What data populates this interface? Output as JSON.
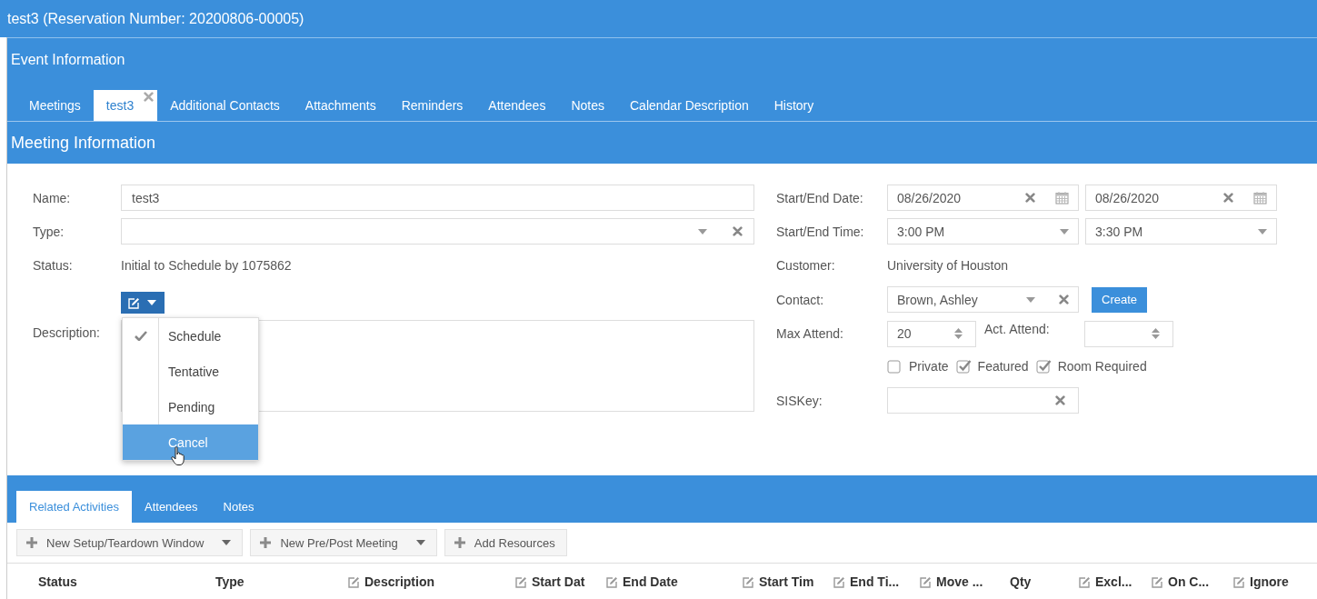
{
  "window": {
    "title": "test3 (Reservation Number: 20200806-00005)"
  },
  "section_title": "Event Information",
  "tabs": [
    {
      "label": "Meetings",
      "selected": false,
      "closable": false
    },
    {
      "label": "test3",
      "selected": true,
      "closable": true
    },
    {
      "label": "Additional Contacts",
      "selected": false,
      "closable": false
    },
    {
      "label": "Attachments",
      "selected": false,
      "closable": false
    },
    {
      "label": "Reminders",
      "selected": false,
      "closable": false
    },
    {
      "label": "Attendees",
      "selected": false,
      "closable": false
    },
    {
      "label": "Notes",
      "selected": false,
      "closable": false
    },
    {
      "label": "Calendar Description",
      "selected": false,
      "closable": false
    },
    {
      "label": "History",
      "selected": false,
      "closable": false
    }
  ],
  "panel_title": "Meeting Information",
  "left_fields": [
    {
      "kind": "text",
      "label": "Name:",
      "value": "test3"
    },
    {
      "kind": "select",
      "label": "Type:"
    },
    {
      "kind": "static",
      "label": "Status:",
      "value": "Initial to Schedule by 1075862"
    },
    {
      "kind": "status-button"
    },
    {
      "kind": "textarea",
      "label": "Description:"
    }
  ],
  "status_menu": [
    {
      "label": "Schedule",
      "checked": true,
      "highlighted": false
    },
    {
      "label": "Tentative",
      "checked": false,
      "highlighted": false
    },
    {
      "label": "Pending",
      "checked": false,
      "highlighted": false
    },
    {
      "label": "Cancel",
      "checked": false,
      "highlighted": true
    }
  ],
  "date_row": {
    "label": "Start/End Date:",
    "start": "08/26/2020",
    "end": "08/26/2020"
  },
  "time_row": {
    "label": "Start/End Time:",
    "start": "3:00 PM",
    "end": "3:30 PM"
  },
  "customer": {
    "label": "Customer:",
    "value": "University of Houston"
  },
  "contact": {
    "label": "Contact:",
    "value": "Brown, Ashley",
    "button": "Create"
  },
  "max_attend": {
    "label": "Max Attend:",
    "value": "20"
  },
  "act_attend": {
    "label": "Act. Attend:"
  },
  "options": [
    {
      "label": "Private",
      "checked": false
    },
    {
      "label": "Featured",
      "checked": true
    },
    {
      "label": "Room Required",
      "checked": true
    }
  ],
  "siskey": {
    "label": "SISKey:"
  },
  "related_tabs": [
    {
      "label": "Related Activities",
      "selected": true
    },
    {
      "label": "Attendees",
      "selected": false
    },
    {
      "label": "Notes",
      "selected": false
    }
  ],
  "toolbar": [
    {
      "label": "New Setup/Teardown Window",
      "dropdown": true
    },
    {
      "label": "New Pre/Post Meeting",
      "dropdown": true
    },
    {
      "label": "Add Resources",
      "dropdown": false
    }
  ],
  "grid_columns": [
    {
      "label": "Status",
      "editable": false
    },
    {
      "label": "Type",
      "editable": false
    },
    {
      "label": "Description",
      "editable": true
    },
    {
      "label": "Start Dat",
      "editable": true
    },
    {
      "label": "End Date",
      "editable": true
    },
    {
      "label": "Start Tim",
      "editable": true
    },
    {
      "label": "End Ti...",
      "editable": true
    },
    {
      "label": "Move ...",
      "editable": true
    },
    {
      "label": "Qty",
      "editable": false
    },
    {
      "label": "Excl...",
      "editable": true
    },
    {
      "label": "On C...",
      "editable": true
    },
    {
      "label": "Ignore",
      "editable": true
    }
  ]
}
